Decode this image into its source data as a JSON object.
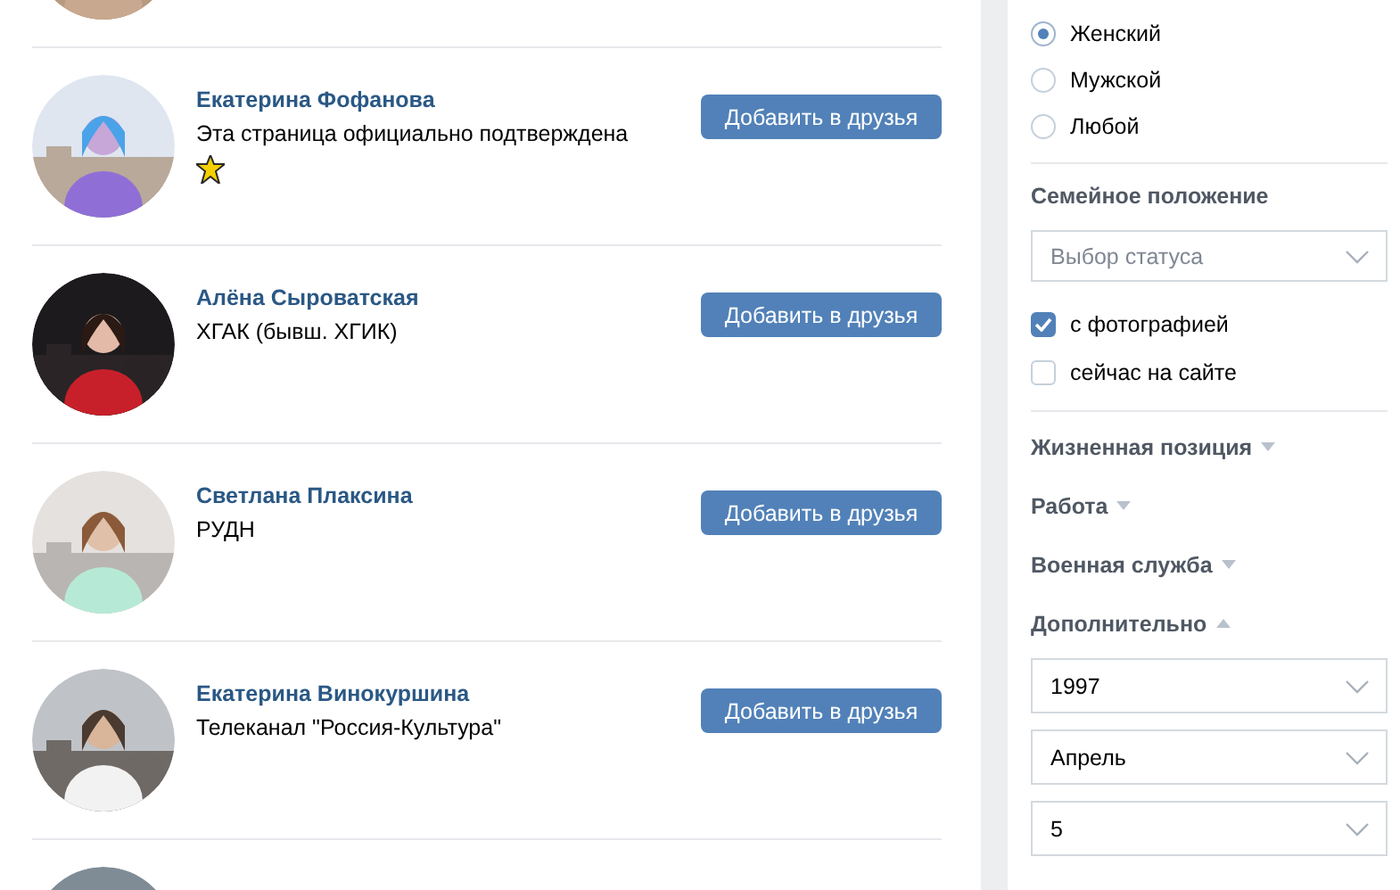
{
  "people": [
    {
      "kind": "partial_top"
    },
    {
      "kind": "full",
      "name": "Екатерина Фофанова",
      "description": "Эта страница официально подтверждена",
      "verified_badge": true,
      "button": "Добавить в друзья"
    },
    {
      "kind": "full",
      "name": "Алёна Сыроватская",
      "description": "ХГАК (бывш. ХГИК)",
      "verified_badge": false,
      "button": "Добавить в друзья"
    },
    {
      "kind": "full",
      "name": "Светлана Плаксина",
      "description": "РУДН",
      "verified_badge": false,
      "button": "Добавить в друзья"
    },
    {
      "kind": "full",
      "name": "Екатерина Винокуршина",
      "description": "Телеканал \"Россия-Культура\"",
      "verified_badge": false,
      "button": "Добавить в друзья"
    },
    {
      "kind": "partial_bottom"
    }
  ],
  "filters": {
    "gender": [
      {
        "label": "Женский",
        "selected": true
      },
      {
        "label": "Мужской",
        "selected": false
      },
      {
        "label": "Любой",
        "selected": false
      }
    ],
    "marital_status": {
      "title": "Семейное положение",
      "placeholder": "Выбор статуса"
    },
    "checkboxes": [
      {
        "label": "с фотографией",
        "checked": true
      },
      {
        "label": "сейчас на сайте",
        "checked": false
      }
    ],
    "sections": [
      {
        "title": "Жизненная позиция",
        "expanded": false
      },
      {
        "title": "Работа",
        "expanded": false
      },
      {
        "title": "Военная служба",
        "expanded": false
      },
      {
        "title": "Дополнительно",
        "expanded": true
      }
    ],
    "birth_date": [
      {
        "value": "1997"
      },
      {
        "value": "Апрель"
      },
      {
        "value": "5"
      }
    ]
  }
}
